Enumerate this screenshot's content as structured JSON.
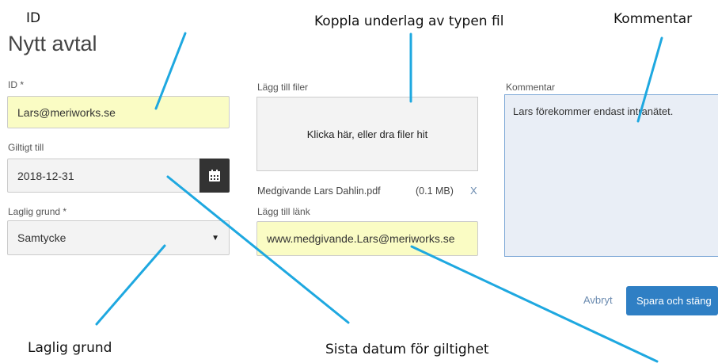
{
  "annotations": {
    "id": "ID",
    "file": "Koppla underlag av typen fil",
    "comment": "Kommentar",
    "legal_basis": "Laglig grund",
    "valid_until": "Sista datum för giltighet"
  },
  "form": {
    "title": "Nytt avtal",
    "id_label": "ID *",
    "id_value": "Lars@meriworks.se",
    "valid_label": "Giltigt till",
    "valid_value": "2018-12-31",
    "legal_label": "Laglig grund *",
    "legal_value": "Samtycke",
    "files_label": "Lägg till filer",
    "dropzone_text": "Klicka här, eller dra filer hit",
    "file_name": "Medgivande Lars Dahlin.pdf",
    "file_size": "(0.1 MB)",
    "file_remove": "X",
    "link_label": "Lägg till länk",
    "link_value": "www.medgivande.Lars@meriworks.se",
    "comment_label": "Kommentar",
    "comment_value": "Lars förekommer endast intranätet.",
    "cancel": "Avbryt",
    "save": "Spara och stäng"
  },
  "colors": {
    "highlight_input": "#fafcc4",
    "annotation_line": "#1ea8e0",
    "primary_button": "#2f7fc4"
  },
  "icons": {
    "calendar": "calendar-icon",
    "dropdown": "caret-down-icon"
  }
}
